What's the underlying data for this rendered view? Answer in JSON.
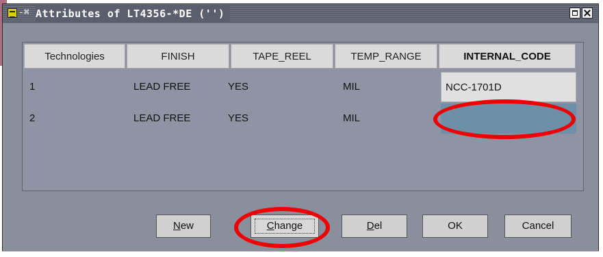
{
  "window": {
    "title": "Attributes of LT4356-*DE ('')",
    "control_glyph": "-⌘",
    "icons": [
      "app-icon",
      "maximize-icon",
      "close-icon"
    ]
  },
  "table": {
    "columns": [
      "Technologies",
      "FINISH",
      "TAPE_REEL",
      "TEMP_RANGE",
      "INTERNAL_CODE"
    ],
    "rows": [
      {
        "technology": "1",
        "finish": "LEAD FREE",
        "tape_reel": "YES",
        "temp_range": "MIL",
        "internal_code": "NCC-1701D"
      },
      {
        "technology": "2",
        "finish": "LEAD FREE",
        "tape_reel": "YES",
        "temp_range": "MIL",
        "internal_code": ""
      }
    ]
  },
  "buttons": {
    "new": {
      "mnemonic": "N",
      "rest": "ew"
    },
    "change": {
      "mnemonic": "C",
      "rest": "hange"
    },
    "del": {
      "mnemonic": "D",
      "rest": "el"
    },
    "ok": "OK",
    "cancel": "Cancel"
  },
  "colors": {
    "window_bg": "#8a8f9e",
    "selected_cell": "#e0e0e0",
    "editing_cell": "#6d8fa8",
    "annotation": "#ee0000"
  }
}
